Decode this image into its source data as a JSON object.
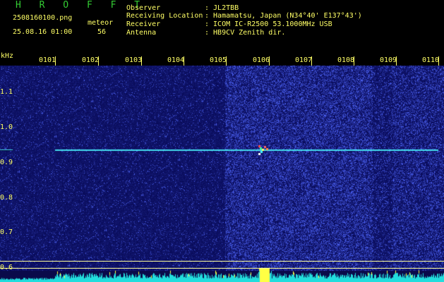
{
  "header": {
    "brand": "H R O F F T",
    "filename": "2508160100.png",
    "datetime": "25.08.16 01:00",
    "mode_label": "meteor",
    "count": "56"
  },
  "station": {
    "observer_label": "Observer",
    "observer_value": ": JL2TBB",
    "location_label": "Receiving Location",
    "location_value": ": Hamamatsu, Japan (N34°40' E137°43')",
    "receiver_label": "Receiver",
    "receiver_value": ": ICOM IC-R2500 53.1000MHz USB",
    "antenna_label": "Antenna",
    "antenna_value": ": HB9CV Zenith dir."
  },
  "axis": {
    "unit": "kHz",
    "x_ticks": [
      "0101",
      "0102",
      "0103",
      "0104",
      "0105",
      "0106",
      "0107",
      "0108",
      "0109",
      "0110"
    ],
    "y_ticks": [
      "1.1",
      "1.0",
      "0.9",
      "0.8",
      "0.7",
      "0.6"
    ]
  },
  "colors": {
    "background": "#0a0a4a",
    "bright_band": "#1a2a9a",
    "carrier": "#44ddee",
    "accent": "#ffff66"
  }
}
